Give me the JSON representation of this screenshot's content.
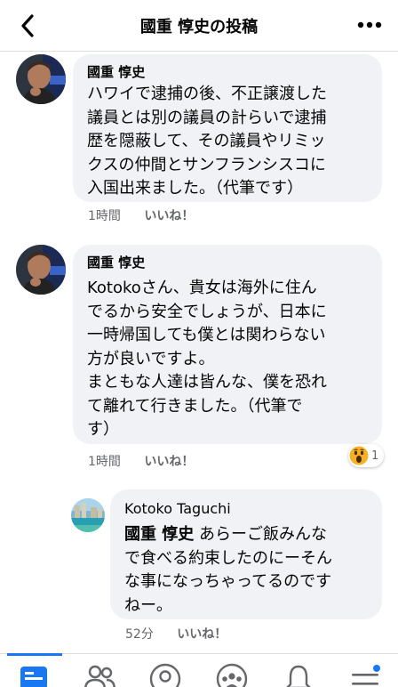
{
  "header": {
    "title": "國重 惇史の投稿",
    "back_icon": "chevron-left-icon",
    "more_icon": "ellipsis-icon"
  },
  "comments": [
    {
      "author": "國重 惇史",
      "text": "ハワイで逮捕の後、不正譲渡した\n議員とは別の議員の計らいで逮捕\n歴を隠蔽して、その議員やリミッ\nクスの仲間とサンフランシスコに\n入国出来ました。（代筆です）",
      "time": "1時間",
      "like": "いいね！"
    },
    {
      "author": "國重 惇史",
      "text": "Kotokoさん、貴女は海外に住ん\nでるから安全でしょうが、日本に\n一時帰国しても僕とは関わらない\n方が良いですよ。\nまともな人達は皆んな、僕を恐れ\nて離れて行きました。（代筆で\nす）",
      "time": "1時間",
      "like": "いいね！",
      "reaction": {
        "icon": "wow-emoji-icon",
        "count": "1"
      }
    },
    {
      "author": "Kotoko Taguchi",
      "mention": "國重 惇史",
      "text": " あらーご飯みんな\nで食べる約束したのにーそん\nな事になっちゃってるのです\nねー。",
      "time": "52分",
      "like": "いいね！"
    }
  ],
  "tabbar": {
    "items": [
      "feed-icon",
      "friends-icon",
      "profile-icon",
      "groups-icon",
      "notifications-icon",
      "menu-icon"
    ],
    "active_color": "#1877f2"
  }
}
